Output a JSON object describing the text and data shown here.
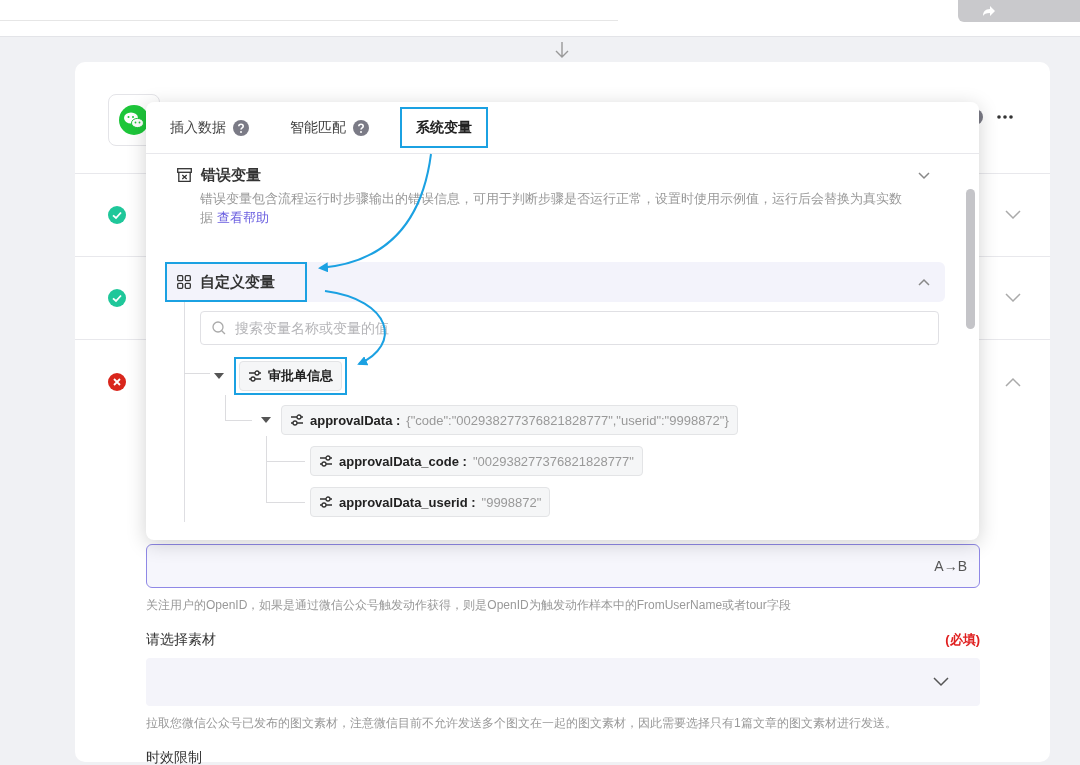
{
  "steps": [
    {
      "kind": "success",
      "expanded": false
    },
    {
      "kind": "success",
      "expanded": false
    },
    {
      "kind": "error",
      "expanded": true
    }
  ],
  "popup": {
    "tabs": [
      {
        "label": "插入数据",
        "help": true,
        "selected": false,
        "highlighted": false
      },
      {
        "label": "智能匹配",
        "help": true,
        "selected": false,
        "highlighted": false
      },
      {
        "label": "系统变量",
        "help": false,
        "selected": true,
        "highlighted": true
      }
    ],
    "sections": [
      {
        "kind": "error",
        "title": "错误变量",
        "expanded": false,
        "highlighted": false,
        "description": "错误变量包含流程运行时步骤输出的错误信息，可用于判断步骤是否运行正常，设置时使用示例值，运行后会替换为真实数据",
        "help_link": "查看帮助"
      },
      {
        "kind": "custom",
        "title": "自定义变量",
        "expanded": true,
        "highlighted": true,
        "search": {
          "placeholder": "搜索变量名称或变量的值"
        },
        "tree": [
          {
            "label": "审批单信息",
            "expanded": true,
            "highlighted": true,
            "children": [
              {
                "label": "approvalData :",
                "value": "{\"code\":\"002938277376821828777\",\"userid\":\"9998872\"}",
                "expanded": true,
                "highlighted": false,
                "children": [
                  {
                    "label": "approvalData_code :",
                    "value": "\"002938277376821828777\"",
                    "highlighted": false
                  },
                  {
                    "label": "approvalData_userid :",
                    "value": "\"9998872\"",
                    "highlighted": false
                  }
                ]
              }
            ]
          }
        ]
      }
    ]
  },
  "form": {
    "openid_field": {
      "button": "A→B"
    },
    "openid_hint": "关注用户的OpenID，如果是通过微信公众号触发动作获得，则是OpenID为触发动作样本中的FromUserName或者tour字段",
    "material": {
      "label": "请选择素材",
      "required": "(必填)",
      "hint": "拉取您微信公众号已发布的图文素材，注意微信目前不允许发送多个图文在一起的图文素材，因此需要选择只有1篇文章的图文素材进行发送。"
    },
    "next_label": "时效限制"
  }
}
